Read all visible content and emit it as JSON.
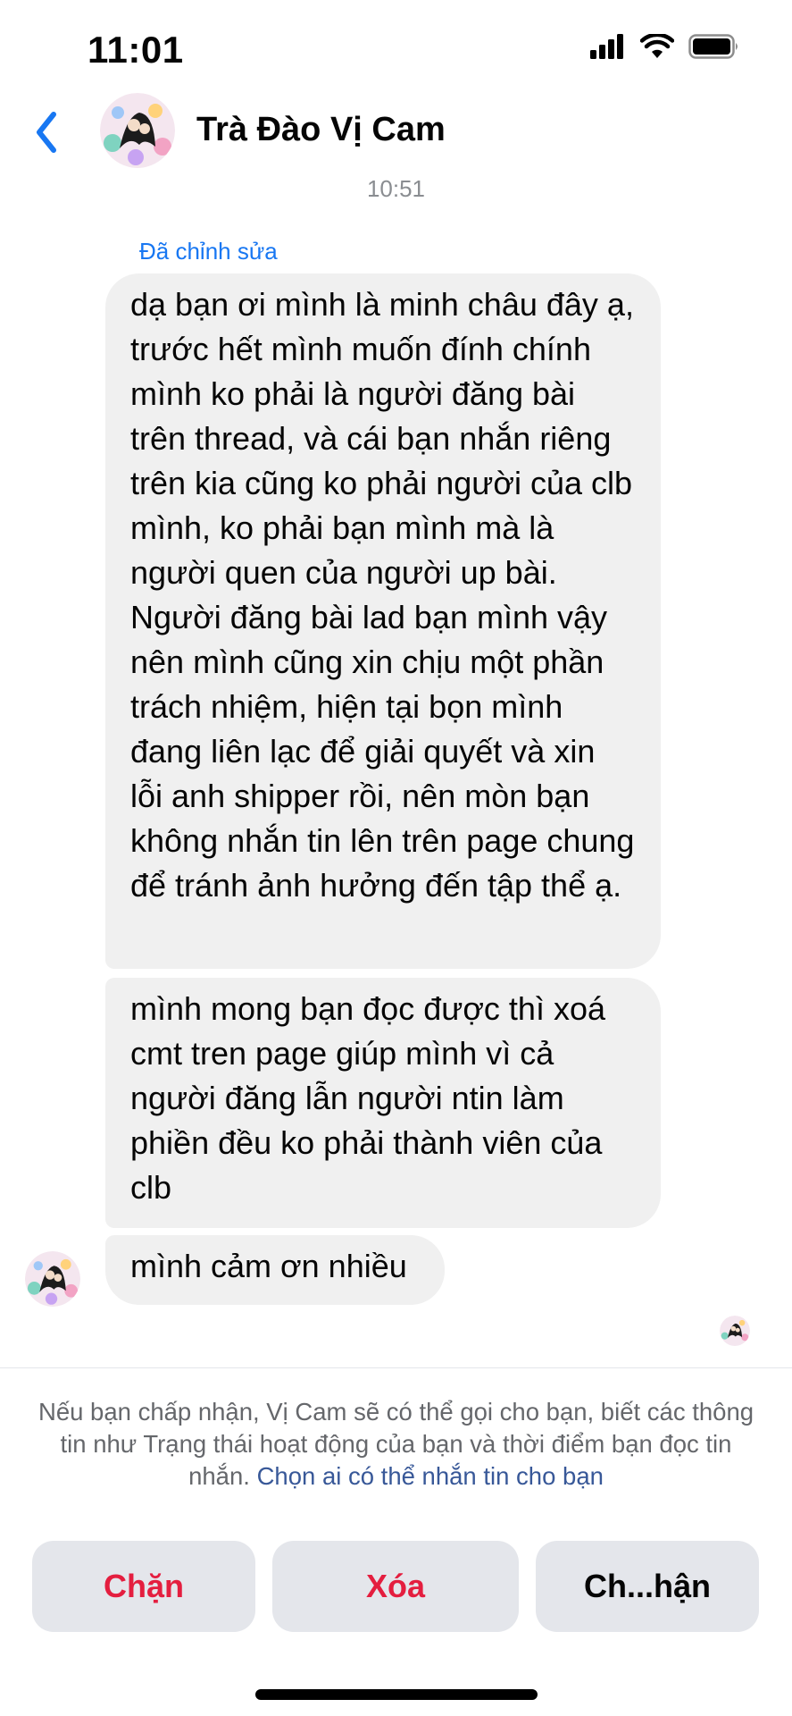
{
  "status_bar": {
    "time": "11:01",
    "icons": [
      "signal-icon",
      "wifi-icon",
      "battery-icon"
    ]
  },
  "header": {
    "back_icon": "chevron-left-icon",
    "contact_name": "Trà Đào Vị Cam",
    "accent_color": "#1877f2"
  },
  "conversation": {
    "timestamp": "10:51",
    "edited_label": "Đã chỉnh sửa",
    "messages": [
      {
        "text": "dạ bạn ơi mình là minh châu đây ạ, trước hết mình muốn đính chính mình ko phải là người đăng bài trên thread, và cái bạn nhắn riêng trên kia cũng ko phải người của clb mình, ko phải bạn mình mà là người quen của người up bài. Người đăng bài lad bạn mình vậy nên mình cũng xin chịu một phần trách nhiệm, hiện tại bọn mình đang liên lạc để giải quyết và xin lỗi anh shipper rồi, nên mòn bạn không nhắn tin lên trên page chung để tránh ảnh hưởng đến tập thể ạ."
      },
      {
        "text": "mình mong bạn đọc được thì xoá cmt tren page giúp mình vì cả người đăng lẫn người ntin làm phiền đều ko phải thành viên của clb"
      },
      {
        "text": "mình cảm ơn nhiều"
      }
    ]
  },
  "request_notice": {
    "text": "Nếu bạn chấp nhận, Vị Cam sẽ có thể gọi cho bạn, biết các thông tin như Trạng thái hoạt động của bạn và thời điểm bạn đọc tin nhắn.",
    "link_text": "Chọn ai có thể nhắn tin cho bạn"
  },
  "actions": {
    "block_label": "Chặn",
    "delete_label": "Xóa",
    "accept_label": "Ch...hận",
    "danger_color": "#e41e3f"
  }
}
